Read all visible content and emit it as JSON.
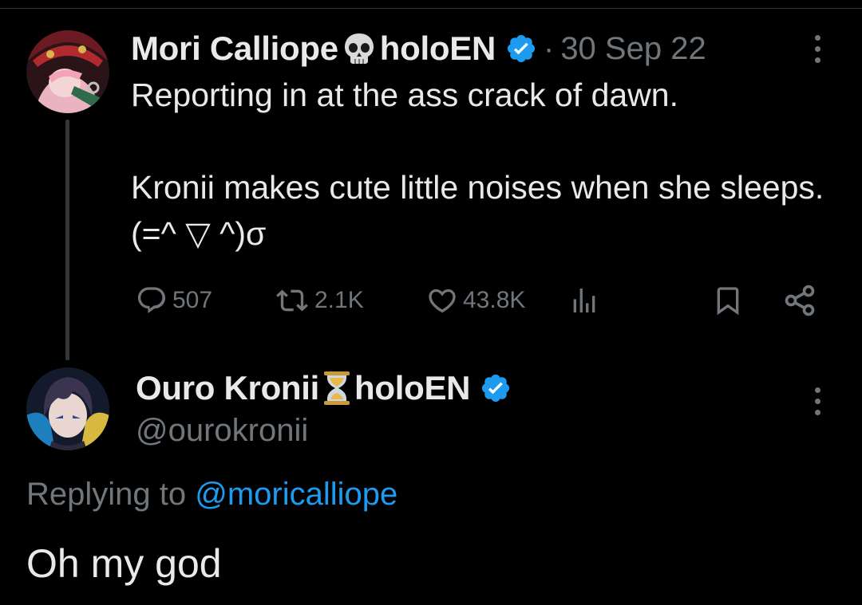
{
  "parent_tweet": {
    "display_name": "Mori Calliope",
    "name_emoji": "skull-icon",
    "name_suffix": "holoEN",
    "separator": "·",
    "date": "30 Sep 22",
    "text_lines": [
      "Reporting in at the ass crack of dawn.",
      "Kronii makes cute little noises when she sleeps. (=^ ▽ ^)σ"
    ],
    "actions": {
      "replies": "507",
      "retweets": "2.1K",
      "likes": "43.8K"
    }
  },
  "reply_tweet": {
    "display_name": "Ouro Kronii",
    "name_emoji": "hourglass-icon",
    "name_suffix": "holoEN",
    "handle": "@ourokronii",
    "replying_prefix": "Replying to",
    "replying_to": "@moricalliope",
    "text": "Oh my god"
  },
  "colors": {
    "background": "#000000",
    "text": "#e7e9ea",
    "muted": "#71767b",
    "accent": "#1d9bf0"
  }
}
